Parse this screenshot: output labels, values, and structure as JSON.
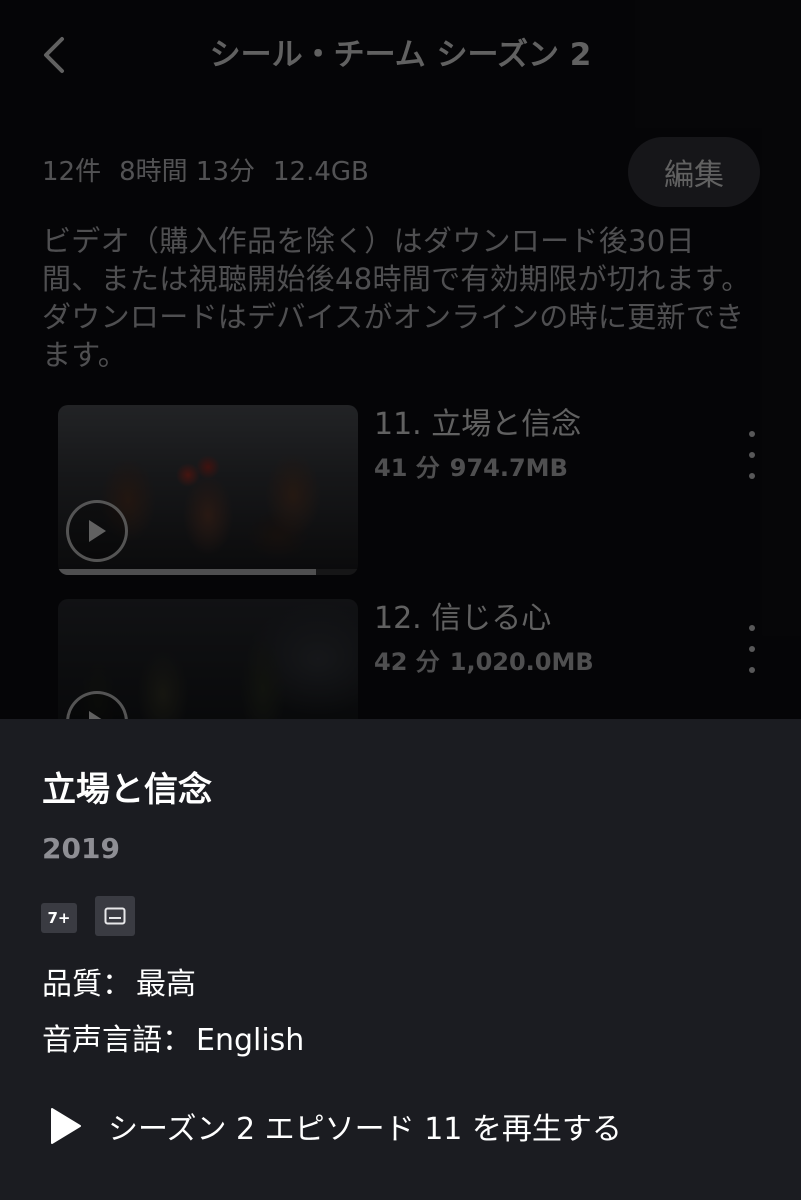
{
  "header": {
    "title": "シール・チーム シーズン 2"
  },
  "summary": {
    "count": "12件",
    "duration": "8時間 13分",
    "size": "12.4GB",
    "edit_label": "編集"
  },
  "notice": "ビデオ（購入作品を除く）はダウンロード後30日間、または視聴開始後48時間で有効期限が切れます。ダウンロードはデバイスがオンラインの時に更新できます。",
  "episodes": [
    {
      "title": "11. 立場と信念",
      "duration": "41 分",
      "size": "974.7MB",
      "progress_percent": 86
    },
    {
      "title": "12. 信じる心",
      "duration": "42 分",
      "size": "1,020.0MB"
    }
  ],
  "sheet": {
    "title": "立場と信念",
    "year": "2019",
    "rating": "7+",
    "subtitle_icon": "subtitles-icon",
    "quality_label": "品質：",
    "quality_value": "最高",
    "audio_label": "音声言語：",
    "audio_value": "English",
    "play_label": "シーズン 2 エピソード 11 を再生する"
  }
}
